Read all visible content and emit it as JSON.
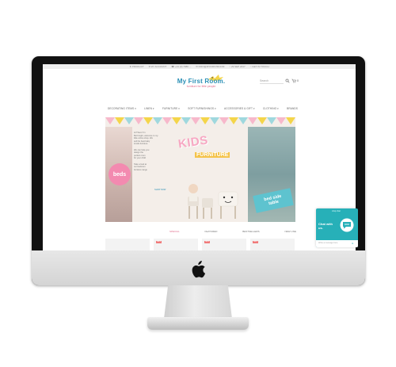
{
  "screen": {
    "topbar": {
      "items": [
        "★ PRODUCT",
        "♥ MY ACCOUNT",
        "☎ +44 (0) 7986 ...",
        "✉ INFO@MYFIRSTROOM",
        "○ 29 SEP 2017",
        "○ GET IN TOUCH"
      ]
    },
    "logo": {
      "title": "My First Room.",
      "tagline": "furniture for little people"
    },
    "header": {
      "search_placeholder": "Search",
      "cart_count": "0"
    },
    "nav": {
      "items": [
        "DECORATING ITEMS ▾",
        "LINEN ▾",
        "FURNITURE ▾",
        "SOFT FURNISHINGS ▾",
        "ACCESSORIES & GIFT ▾",
        "CLOTHING ▾",
        "BRANDS"
      ]
    },
    "hero": {
      "kids_word": "KIDS",
      "furniture_word": "FURNITURE",
      "beds_label": "beds",
      "bedside_line1": "bed side",
      "bedside_line2": "table",
      "text_lines": [
        "Hi There! I'm",
        "Bel Knight, welcome to my",
        "little online shop. We",
        "sell the best baby",
        "& kids furniture",
        "",
        "We can help you",
        "design the",
        "perfect room",
        "for your child",
        "",
        "Take a look at",
        "our bedroom",
        "furniture range"
      ],
      "shop_link": "SHOP NOW"
    },
    "tabs": {
      "items": [
        "SPECIAL",
        "FEATURED",
        "BESTSELLERS",
        "NEW LINE"
      ]
    },
    "products": {
      "sale_label": "SALE"
    },
    "chat": {
      "brand": "crisp chat",
      "message": "Chat with us.",
      "input_placeholder": "Write a message here",
      "send": "➤"
    }
  },
  "colors": {
    "accent_blue": "#2a8fb5",
    "accent_pink": "#f38ab0",
    "accent_teal": "#27b0b8",
    "accent_yellow": "#f4c34a"
  }
}
